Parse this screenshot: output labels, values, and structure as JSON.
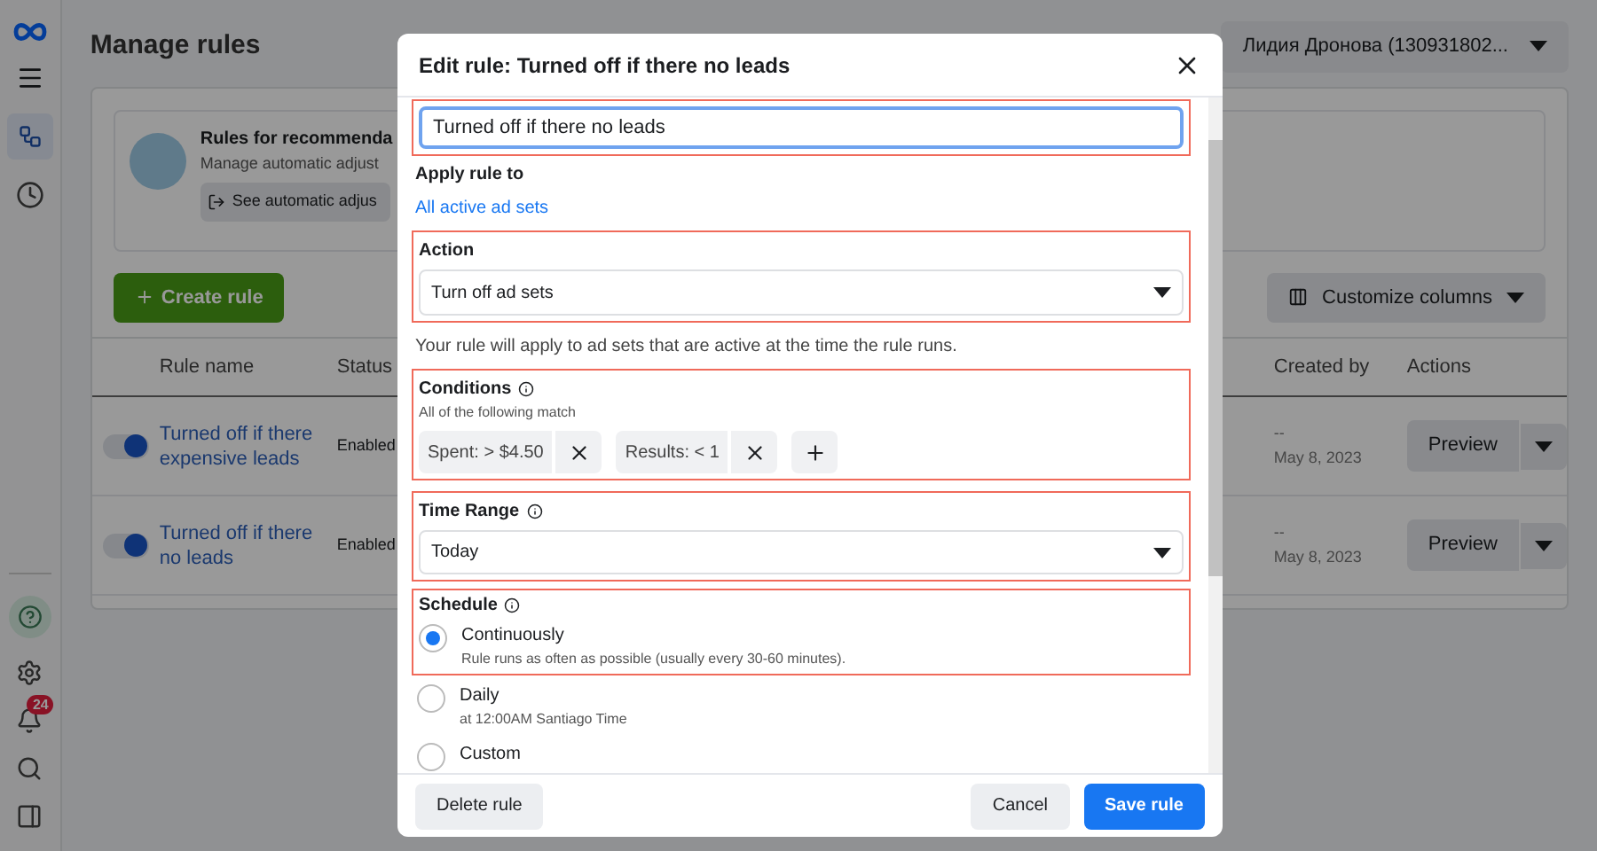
{
  "sidebar": {
    "notification_badge": "24"
  },
  "page": {
    "title": "Manage rules",
    "account": "Лидия Дронова (130931802...",
    "banner": {
      "title": "Rules for recommenda",
      "subtitle": "Manage automatic adjust",
      "button": "See automatic adjus"
    },
    "create_button": "Create rule",
    "customize_button": "Customize columns",
    "table": {
      "columns": [
        "Rule name",
        "Status",
        "Created by",
        "Actions"
      ],
      "rows": [
        {
          "on": true,
          "name": "Turned off if there expensive leads",
          "status": "Enabled",
          "created_by": "--",
          "date": "May 8, 2023",
          "action": "Preview"
        },
        {
          "on": true,
          "name": "Turned off if there no leads",
          "status": "Enabled",
          "created_by": "--",
          "date": "May 8, 2023",
          "action": "Preview"
        }
      ]
    }
  },
  "modal": {
    "title": "Edit rule: Turned off if there no leads",
    "name_field": {
      "value": "Turned off if there no leads",
      "highlighted": true
    },
    "apply": {
      "label": "Apply rule to",
      "link": "All active ad sets"
    },
    "action": {
      "label": "Action",
      "value": "Turn off ad sets",
      "highlighted": true
    },
    "action_note": "Your rule will apply to ad sets that are active at the time the rule runs.",
    "conditions": {
      "label": "Conditions",
      "sublabel": "All of the following match",
      "highlighted": true,
      "items": [
        {
          "field": "Spent:",
          "operator": ">",
          "value": "$4.50"
        },
        {
          "field": "Results:",
          "operator": "<",
          "value": "1"
        }
      ]
    },
    "time_range": {
      "label": "Time Range",
      "value": "Today",
      "highlighted": true
    },
    "schedule": {
      "label": "Schedule",
      "highlighted": true,
      "options": [
        {
          "label": "Continuously",
          "description": "Rule runs as often as possible (usually every 30-60 minutes).",
          "selected": true
        },
        {
          "label": "Daily",
          "description": "at 12:00AM Santiago Time",
          "selected": false
        },
        {
          "label": "Custom",
          "selected": false
        }
      ]
    },
    "buttons": {
      "delete": "Delete rule",
      "cancel": "Cancel",
      "save": "Save rule"
    }
  }
}
